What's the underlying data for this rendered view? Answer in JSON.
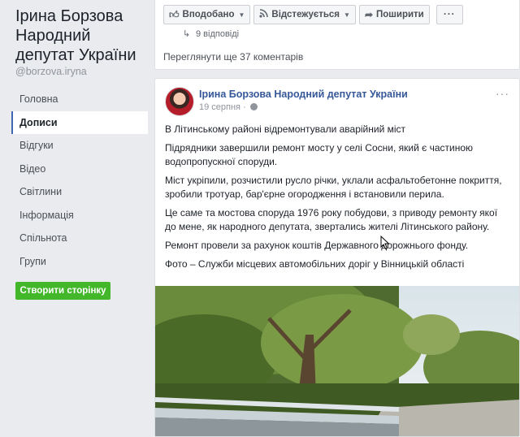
{
  "sidebar": {
    "page_name": "Ірина Борзова Народний депутат України",
    "handle": "@borzova.iryna",
    "nav": [
      {
        "label": "Головна"
      },
      {
        "label": "Дописи"
      },
      {
        "label": "Відгуки"
      },
      {
        "label": "Відео"
      },
      {
        "label": "Світлини"
      },
      {
        "label": "Інформація"
      },
      {
        "label": "Спільнота"
      },
      {
        "label": "Групи"
      }
    ],
    "create_page_label": "Створити сторінку"
  },
  "top_card": {
    "liked_label": "Вподобано",
    "following_label": "Відстежується",
    "share_label": "Поширити",
    "more_label": "···",
    "replies_text": "9 відповіді",
    "view_comments": "Переглянути ще 37 коментарів"
  },
  "post": {
    "author": "Ірина Борзова Народний депутат України",
    "date": "19 серпня ·",
    "more_label": "···",
    "paragraphs": [
      "В Літинському районі відремонтували аварійний міст",
      "Підрядники завершили ремонт мосту у селі Сосни, який є частиною водопропускної споруди.",
      "Міст укріпили, розчистили русло річки, уклали асфальтобетонне покриття, зробили тротуар, бар'єрне огородження і встановили перила.",
      "Це саме та мостова споруда 1976 року побудови, з приводу ремонту якої до мене, як народного депутата, звертались жителі Літинського району.",
      "Ремонт провели за рахунок коштів Державного дорожнього фонду.",
      "Фото – Служби місцевих автомобільних доріг у Вінницькій області"
    ]
  },
  "colors": {
    "accent": "#4267b2",
    "link": "#365899",
    "create_button": "#42b72a",
    "background": "#e9ebee"
  },
  "icons": [
    "thumbs-up-icon",
    "rss-icon",
    "share-icon",
    "globe-icon",
    "caret-down-icon",
    "mouse-cursor-icon"
  ]
}
